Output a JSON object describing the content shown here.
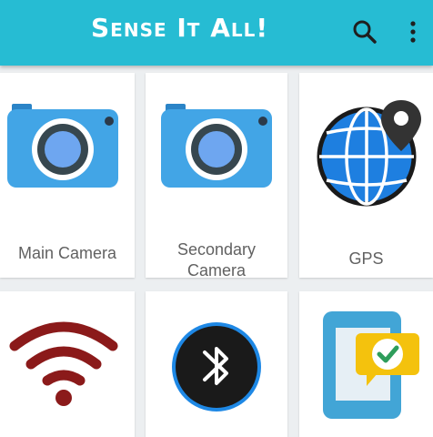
{
  "app": {
    "title": "Sense It All!",
    "toolbar": {
      "search_icon": "search-icon",
      "menu_icon": "more-vert-icon"
    },
    "colors": {
      "primary": "#26bcd3",
      "background": "#eceff1",
      "card": "#ffffff"
    }
  },
  "sensors": [
    {
      "label": "Main Camera",
      "icon": "camera-icon"
    },
    {
      "label": "Secondary Camera",
      "icon": "camera-icon"
    },
    {
      "label": "GPS",
      "icon": "globe-location-icon"
    },
    {
      "label": "",
      "icon": "wifi-icon"
    },
    {
      "label": "",
      "icon": "bluetooth-icon"
    },
    {
      "label": "",
      "icon": "phone-check-icon"
    }
  ]
}
